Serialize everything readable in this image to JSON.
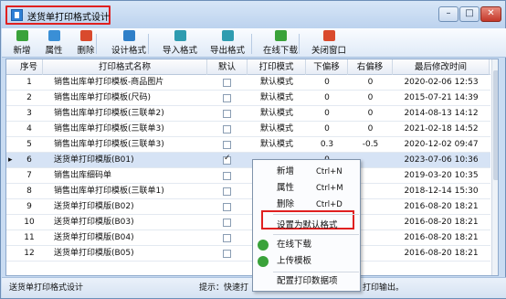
{
  "window": {
    "title": "送货单打印格式设计"
  },
  "toolbar": {
    "items": [
      {
        "label": "新增",
        "color": "#3aa23a",
        "icon": "add-icon"
      },
      {
        "label": "属性",
        "color": "#3a8fd6",
        "icon": "edit-icon"
      },
      {
        "label": "删除",
        "color": "#d94a2d",
        "icon": "delete-icon"
      },
      {
        "label": "设计格式",
        "color": "#2f7fc8",
        "icon": "design-icon"
      },
      {
        "label": "导入格式",
        "color": "#2f9cb0",
        "icon": "import-icon"
      },
      {
        "label": "导出格式",
        "color": "#2f9cb0",
        "icon": "export-icon"
      },
      {
        "label": "在线下载",
        "color": "#3aa23a",
        "icon": "download-icon"
      },
      {
        "label": "关闭窗口",
        "color": "#d94a2d",
        "icon": "close-window-icon"
      }
    ]
  },
  "table": {
    "columns": [
      "序号",
      "打印格式名称",
      "默认",
      "打印模式",
      "下偏移",
      "右偏移",
      "最后修改时间"
    ],
    "rows": [
      {
        "no": "1",
        "name": "销售出库单打印模板-商品图片",
        "default": false,
        "mode": "默认模式",
        "down": "0",
        "right": "0",
        "modified": "2020-02-06 12:53"
      },
      {
        "no": "2",
        "name": "销售出库单打印模板(尺码)",
        "default": false,
        "mode": "默认模式",
        "down": "0",
        "right": "0",
        "modified": "2015-07-21 14:39"
      },
      {
        "no": "3",
        "name": "销售出库单打印模板(三联单2)",
        "default": false,
        "mode": "默认模式",
        "down": "0",
        "right": "0",
        "modified": "2014-08-13 14:12"
      },
      {
        "no": "4",
        "name": "销售出库单打印模板(三联单3)",
        "default": false,
        "mode": "默认模式",
        "down": "0",
        "right": "0",
        "modified": "2021-02-18 14:52"
      },
      {
        "no": "5",
        "name": "销售出库单打印模板(三联单3)",
        "default": false,
        "mode": "默认模式",
        "down": "0.3",
        "right": "-0.5",
        "modified": "2020-12-02 09:47"
      },
      {
        "no": "6",
        "name": "送货单打印模版(B01)",
        "default": true,
        "mode": "",
        "down": "0",
        "right": "",
        "modified": "2023-07-06 10:36"
      },
      {
        "no": "7",
        "name": "销售出库细码单",
        "default": false,
        "mode": "",
        "down": "",
        "right": "",
        "modified": "2019-03-20 10:35"
      },
      {
        "no": "8",
        "name": "销售出库单打印模板(三联单1)",
        "default": false,
        "mode": "",
        "down": "",
        "right": "",
        "modified": "2018-12-14 15:30"
      },
      {
        "no": "9",
        "name": "送货单打印模版(B02)",
        "default": false,
        "mode": "",
        "down": "",
        "right": "",
        "modified": "2016-08-20 18:21"
      },
      {
        "no": "10",
        "name": "送货单打印模版(B03)",
        "default": false,
        "mode": "",
        "down": "",
        "right": "",
        "modified": "2016-08-20 18:21"
      },
      {
        "no": "11",
        "name": "送货单打印模版(B04)",
        "default": false,
        "mode": "",
        "down": "",
        "right": "",
        "modified": "2016-08-20 18:21"
      },
      {
        "no": "12",
        "name": "送货单打印模版(B05)",
        "default": false,
        "mode": "",
        "down": "",
        "right": "",
        "modified": "2016-08-20 18:21"
      }
    ],
    "selected_row": "6"
  },
  "context_menu": {
    "items": [
      {
        "label": "新增",
        "shortcut": "Ctrl+N"
      },
      {
        "label": "属性",
        "shortcut": "Ctrl+M"
      },
      {
        "label": "删除",
        "shortcut": "Ctrl+D"
      },
      {
        "label": "设置为默认格式",
        "shortcut": ""
      },
      {
        "label": "在线下载",
        "shortcut": ""
      },
      {
        "label": "上传模板",
        "shortcut": ""
      },
      {
        "label": "配置打印数据项",
        "shortcut": ""
      }
    ]
  },
  "status": {
    "left": "送货单打印格式设计",
    "mid": "提示：快速打",
    "right": "打印输出。"
  }
}
